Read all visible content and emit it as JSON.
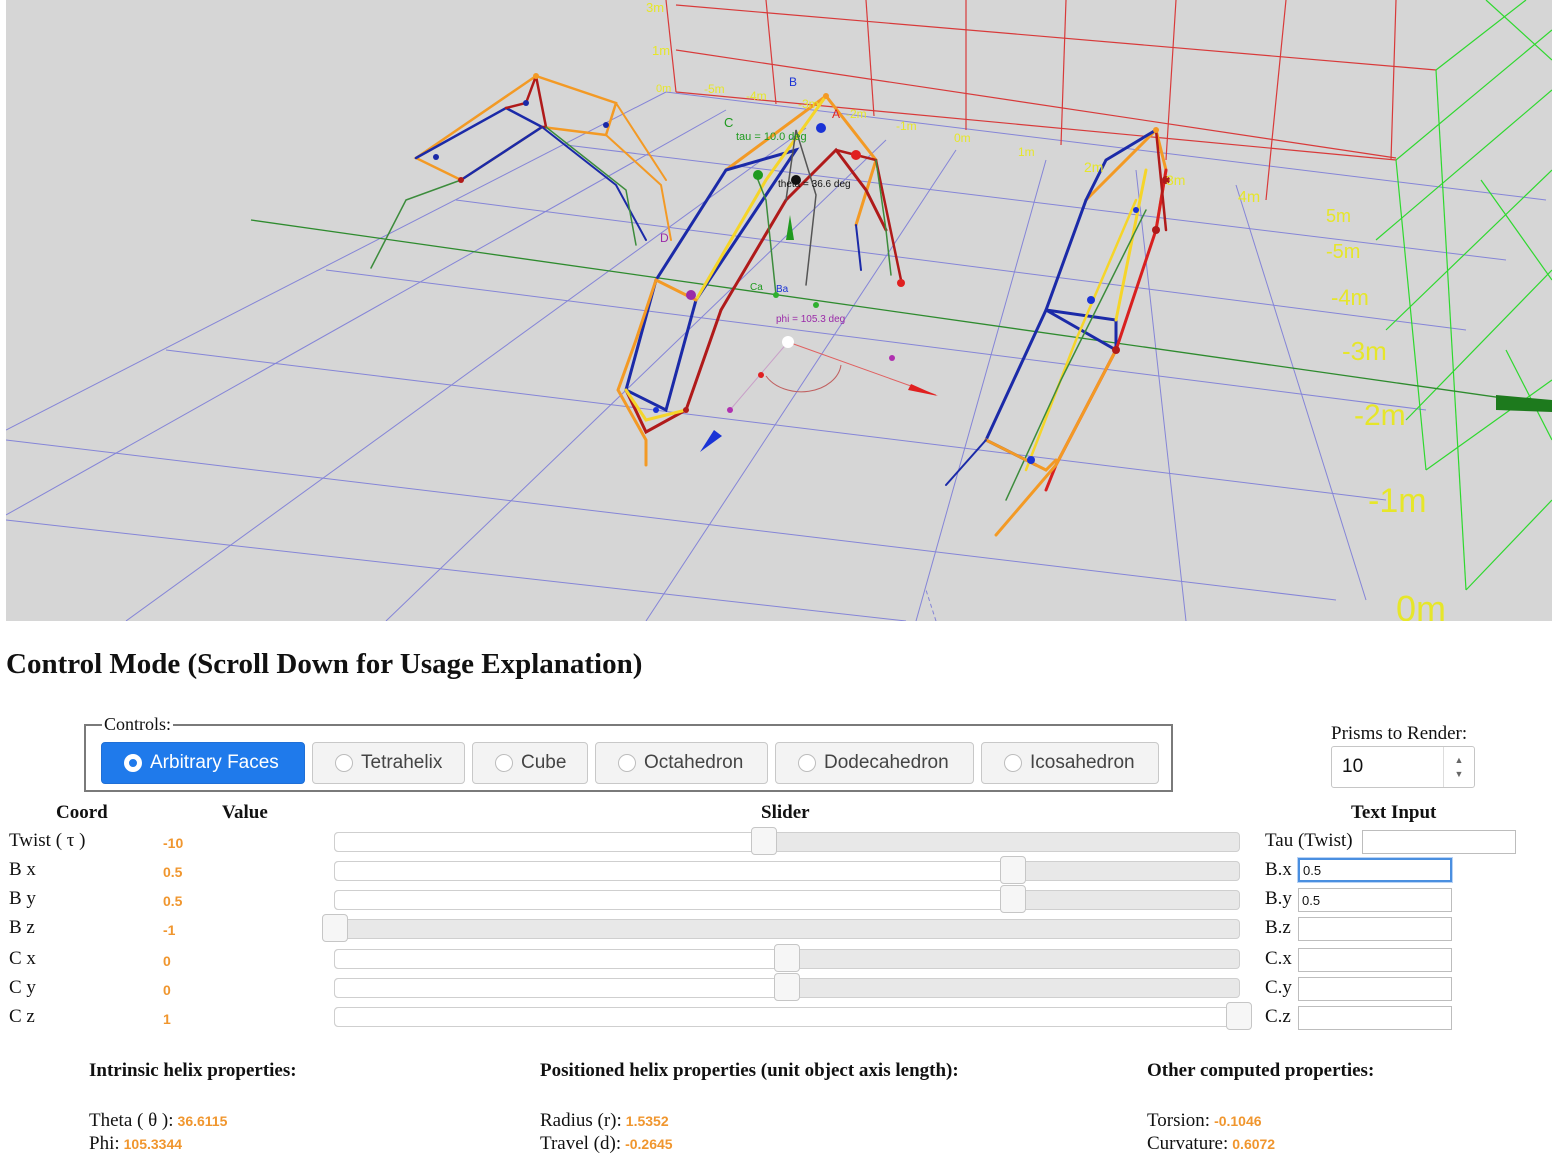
{
  "scene": {
    "wall_labels": [
      "3m",
      "1m",
      "0m",
      "-5m",
      "-4m",
      "-3m",
      "-2m",
      "-1m",
      "0m",
      "1m",
      "2m",
      "3m",
      "4m"
    ],
    "right_wall_labels": [
      "5m",
      "-5m",
      "-4m",
      "-3m",
      "-2m",
      "-1m",
      "0m"
    ],
    "vector_labels": [
      "B",
      "C",
      "A",
      "D",
      "Ca",
      "Ba"
    ],
    "angle_labels": {
      "tau": "tau = 10.0 deg",
      "theta": "theta = 36.6 deg",
      "phi": "phi = 105.3 deg"
    },
    "colors": {
      "background": "#d6d6d6",
      "floor_grid": "#6a6ad8",
      "back_wall": "#d83a3a",
      "right_wall": "#2fd82f",
      "wall_labels": "#e6e62a",
      "prism_blue": "#1b2aa8",
      "prism_red": "#b01a1a",
      "prism_orange": "#f39a25",
      "prism_yellow": "#f5d52a",
      "prism_green": "#3c8c3c"
    }
  },
  "heading": "Control Mode (Scroll Down for Usage Explanation)",
  "controls": {
    "legend": "Controls:",
    "modes": [
      {
        "label": "Arbitrary Faces",
        "active": true
      },
      {
        "label": "Tetrahelix",
        "active": false
      },
      {
        "label": "Cube",
        "active": false
      },
      {
        "label": "Octahedron",
        "active": false
      },
      {
        "label": "Dodecahedron",
        "active": false
      },
      {
        "label": "Icosahedron",
        "active": false
      }
    ]
  },
  "prisms": {
    "label": "Prisms to Render:",
    "value": "10"
  },
  "table": {
    "headers": {
      "coord": "Coord",
      "value": "Value",
      "slider": "Slider",
      "text_input": "Text Input"
    },
    "rows": [
      {
        "coord": "Twist ( τ )",
        "value": "-10",
        "slider_fraction": 0.475,
        "input_label": "Tau (Twist)",
        "input_value": ""
      },
      {
        "coord": "B x",
        "value": "0.5",
        "slider_fraction": 0.75,
        "input_label": "B.x",
        "input_value": "0.5"
      },
      {
        "coord": "B y",
        "value": "0.5",
        "slider_fraction": 0.75,
        "input_label": "B.y",
        "input_value": "0.5"
      },
      {
        "coord": "B z",
        "value": "-1",
        "slider_fraction": 0.0,
        "input_label": "B.z",
        "input_value": ""
      },
      {
        "coord": "C x",
        "value": "0",
        "slider_fraction": 0.5,
        "input_label": "C.x",
        "input_value": ""
      },
      {
        "coord": "C y",
        "value": "0",
        "slider_fraction": 0.5,
        "input_label": "C.y",
        "input_value": ""
      },
      {
        "coord": "C z",
        "value": "1",
        "slider_fraction": 1.0,
        "input_label": "C.z",
        "input_value": ""
      }
    ]
  },
  "properties": {
    "intrinsic": {
      "heading": "Intrinsic helix properties:",
      "theta_label": "Theta ( θ ):",
      "theta_value": "36.6115",
      "phi_label": "Phi:",
      "phi_value": "105.3344"
    },
    "positioned": {
      "heading": "Positioned helix properties (unit object axis length):",
      "radius_label": "Radius (r):",
      "radius_value": "1.5352",
      "travel_label": "Travel (d):",
      "travel_value": "-0.2645"
    },
    "other": {
      "heading": "Other computed properties:",
      "torsion_label": "Torsion:",
      "torsion_value": "-0.1046",
      "curvature_label": "Curvature:",
      "curvature_value": "0.6072"
    }
  }
}
